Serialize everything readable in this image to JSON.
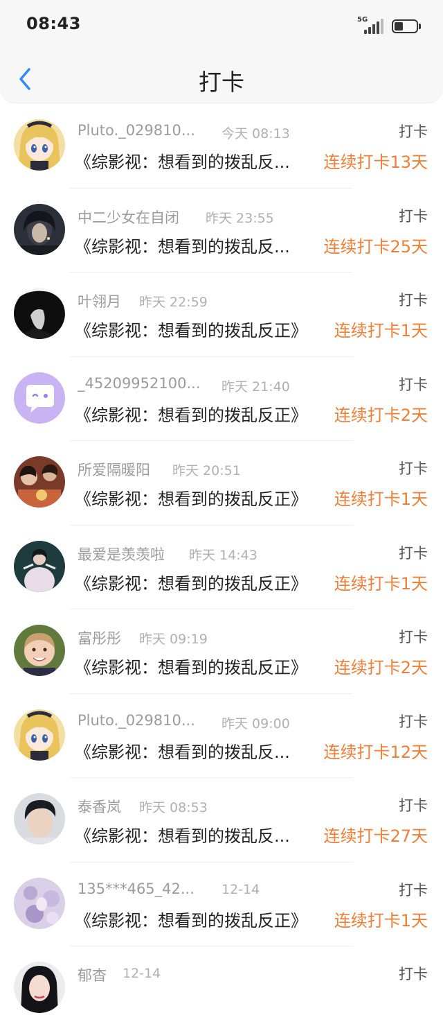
{
  "status_bar": {
    "time": "08:43",
    "network": "5G"
  },
  "header": {
    "title": "打卡"
  },
  "rows": [
    {
      "name": "Pluto._029810...",
      "time": "今天 08:13",
      "action": "打卡",
      "book": "《综影视：想看到的拨乱反...",
      "streak": "连续打卡13天",
      "avatar": "anime-girl-blonde"
    },
    {
      "name": "中二少女在自闭",
      "time": "昨天 23:55",
      "action": "打卡",
      "book": "《综影视：想看到的拨乱反...",
      "streak": "连续打卡25天",
      "avatar": "dark-portrait"
    },
    {
      "name": "叶翎月",
      "time": "昨天 22:59",
      "action": "打卡",
      "book": "《综影视：想看到的拨乱反正》",
      "streak": "连续打卡1天",
      "avatar": "bw-silhouette"
    },
    {
      "name": "_45209952100...",
      "time": "昨天 21:40",
      "action": "打卡",
      "book": "《综影视：想看到的拨乱反正》",
      "streak": "连续打卡2天",
      "avatar": "purple-chat-bubble"
    },
    {
      "name": "所爱隔暖阳",
      "time": "昨天 20:51",
      "action": "打卡",
      "book": "《综影视：想看到的拨乱反正》",
      "streak": "连续打卡1天",
      "avatar": "costume-group"
    },
    {
      "name": "最爱是羡羡啦",
      "time": "昨天 14:43",
      "action": "打卡",
      "book": "《综影视：想看到的拨乱反正》",
      "streak": "连续打卡1天",
      "avatar": "white-dress-figure"
    },
    {
      "name": "富彤彤",
      "time": "昨天 09:19",
      "action": "打卡",
      "book": "《综影视：想看到的拨乱反正》",
      "streak": "连续打卡2天",
      "avatar": "child-face"
    },
    {
      "name": "Pluto._029810...",
      "time": "昨天 09:00",
      "action": "打卡",
      "book": "《综影视：想看到的拨乱反...",
      "streak": "连续打卡12天",
      "avatar": "anime-girl-blonde"
    },
    {
      "name": "泰香岚",
      "time": "昨天 08:53",
      "action": "打卡",
      "book": "《综影视：想看到的拨乱反...",
      "streak": "连续打卡27天",
      "avatar": "male-portrait"
    },
    {
      "name": "135***465_42...",
      "time": "12-14",
      "action": "打卡",
      "book": "《综影视：想看到的拨乱反正》",
      "streak": "连续打卡1天",
      "avatar": "lavender-floral"
    },
    {
      "name": "郁杳",
      "time": "12-14",
      "action": "打卡",
      "book": "",
      "streak": "",
      "avatar": "female-portrait-dark-hair"
    }
  ],
  "colors": {
    "accent": "#2d8cf0",
    "streak": "#ef7f38",
    "name": "#9b9b9b",
    "time": "#b0b0b0"
  }
}
